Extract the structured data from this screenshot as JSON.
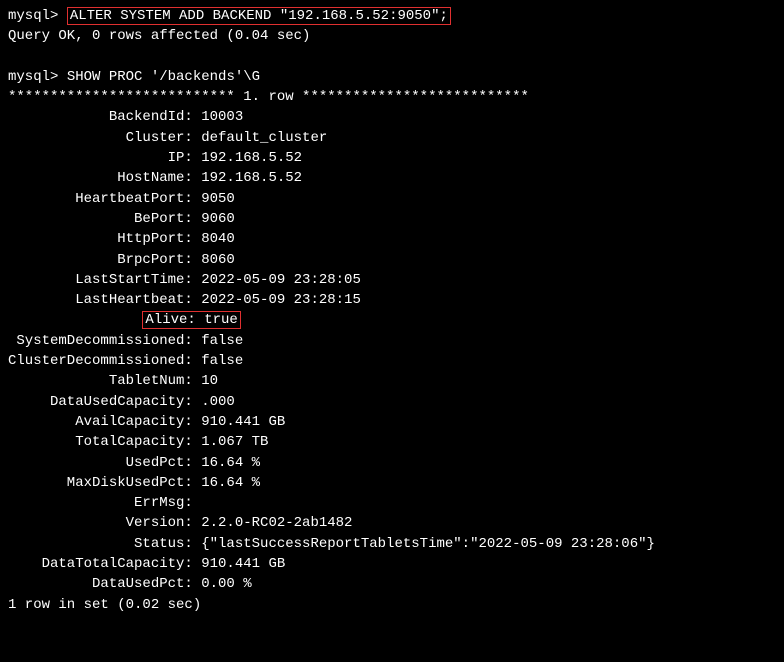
{
  "prompt": "mysql> ",
  "cmd1": "ALTER SYSTEM ADD BACKEND \"192.168.5.52:9050\";",
  "result1": "Query OK, 0 rows affected (0.04 sec)",
  "cmd2": "SHOW PROC '/backends'\\G",
  "row_header": "*************************** 1. row ***************************",
  "fields": {
    "BackendId": "10003",
    "Cluster": "default_cluster",
    "IP": "192.168.5.52",
    "HostName": "192.168.5.52",
    "HeartbeatPort": "9050",
    "BePort": "9060",
    "HttpPort": "8040",
    "BrpcPort": "8060",
    "LastStartTime": "2022-05-09 23:28:05",
    "LastHeartbeat": "2022-05-09 23:28:15",
    "Alive": "true",
    "SystemDecommissioned": "false",
    "ClusterDecommissioned": "false",
    "TabletNum": "10",
    "DataUsedCapacity": ".000 ",
    "AvailCapacity": "910.441 GB",
    "TotalCapacity": "1.067 TB",
    "UsedPct": "16.64 %",
    "MaxDiskUsedPct": "16.64 %",
    "ErrMsg": "",
    "Version": "2.2.0-RC02-2ab1482",
    "Status": "{\"lastSuccessReportTabletsTime\":\"2022-05-09 23:28:06\"}",
    "DataTotalCapacity": "910.441 GB",
    "DataUsedPct": "0.00 %"
  },
  "footer": "1 row in set (0.02 sec)",
  "label_width": 21
}
